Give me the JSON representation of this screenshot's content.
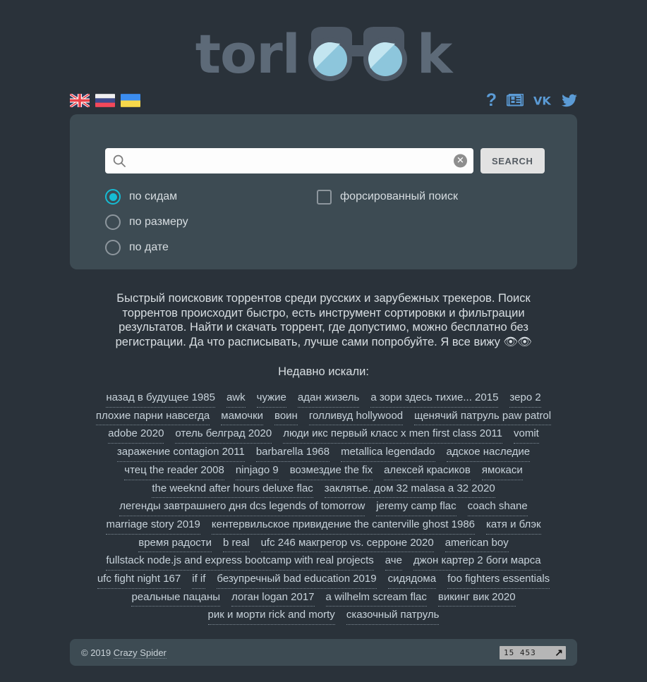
{
  "site": {
    "logo_text_left": "torl",
    "logo_text_right": "k",
    "logo_alt": "torlook"
  },
  "topbar": {
    "languages": [
      {
        "name": "english",
        "code": "en",
        "label": "English"
      },
      {
        "name": "russian",
        "code": "ru",
        "label": "Русский"
      },
      {
        "name": "ukrainian",
        "code": "uk",
        "label": "Українська"
      }
    ],
    "socials": [
      {
        "name": "help-icon",
        "glyph": "?"
      },
      {
        "name": "news-icon",
        "glyph": "news"
      },
      {
        "name": "vk-icon",
        "glyph": "VK"
      },
      {
        "name": "twitter-icon",
        "glyph": "twitter"
      }
    ]
  },
  "search": {
    "value": "",
    "placeholder": "",
    "button_label": "SEARCH",
    "clear_label": "✕",
    "sort_options": [
      {
        "label": "по сидам",
        "selected": true
      },
      {
        "label": "по размеру",
        "selected": false
      },
      {
        "label": "по дате",
        "selected": false
      }
    ],
    "forced_search": {
      "label": "форсированный поиск",
      "checked": false
    }
  },
  "description": {
    "text": "Быстрый поисковик торрентов среди русских и зарубежных трекеров. Поиск торрентов происходит быстро, есть инструмент сортировки и фильтрации результатов. Найти и скачать торрент, где допустимо, можно бесплатно без регистрации. Да что расписывать, лучше сами попробуйте. Я все вижу ",
    "eyes": "👁👁"
  },
  "recent": {
    "title": "Недавно искали:",
    "rows": [
      [
        "назад в будущее 1985",
        "awk",
        "чужие",
        "адан жизель",
        "а зори здесь тихие... 2015",
        "зеро 2"
      ],
      [
        "плохие парни навсегда",
        "мамочки",
        "воин",
        "голливуд hollywood",
        "щенячий патруль paw patrol"
      ],
      [
        "adobe 2020",
        "отель белград 2020",
        "люди икс первый класс x men first class 2011",
        "vomit"
      ],
      [
        "заражение contagion 2011",
        "barbarella 1968",
        "metallica legendado",
        "адское наследие"
      ],
      [
        "чтец the reader 2008",
        "ninjago 9",
        "возмездие the fix",
        "алексей красиков",
        "ямокаси"
      ],
      [
        "the weeknd after hours deluxe flac",
        "заклятье. дом 32 malasa a 32 2020"
      ],
      [
        "легенды завтрашнего дня dcs legends of tomorrow",
        "jeremy camp flac",
        "coach shane"
      ],
      [
        "marriage story 2019",
        "кентервильское привидение the canterville ghost 1986",
        "катя и блэк"
      ],
      [
        "время радости",
        "b real",
        "ufc 246 макгрегор vs. серроне 2020",
        "american boy"
      ],
      [
        "fullstack node.js and express bootcamp with real projects",
        "аче",
        "джон картер 2 боги марса"
      ],
      [
        "ufc fight night 167",
        "if if",
        "безупречный bad education 2019",
        "сидядома",
        "foo fighters essentials"
      ],
      [
        "реальные пацаны",
        "логан logan 2017",
        "a wilhelm scream flac",
        "викинг вик 2020"
      ],
      [
        "рик и морти rick and morty",
        "сказочный патруль"
      ]
    ]
  },
  "footer": {
    "copyright": "© 2019 ",
    "author": "Crazy Spider",
    "counter_value": "15 453",
    "counter_arrow": "↗"
  },
  "colors": {
    "background": "#2a323a",
    "panel": "#3d4b53",
    "accent_cyan": "#16bcd4",
    "logo_grey": "#5d6a78",
    "lens_blue": "#a9dbe8",
    "social_blue": "#5b9bd5",
    "text_light": "#d8dee2",
    "tag_text": "#c7d2da"
  }
}
